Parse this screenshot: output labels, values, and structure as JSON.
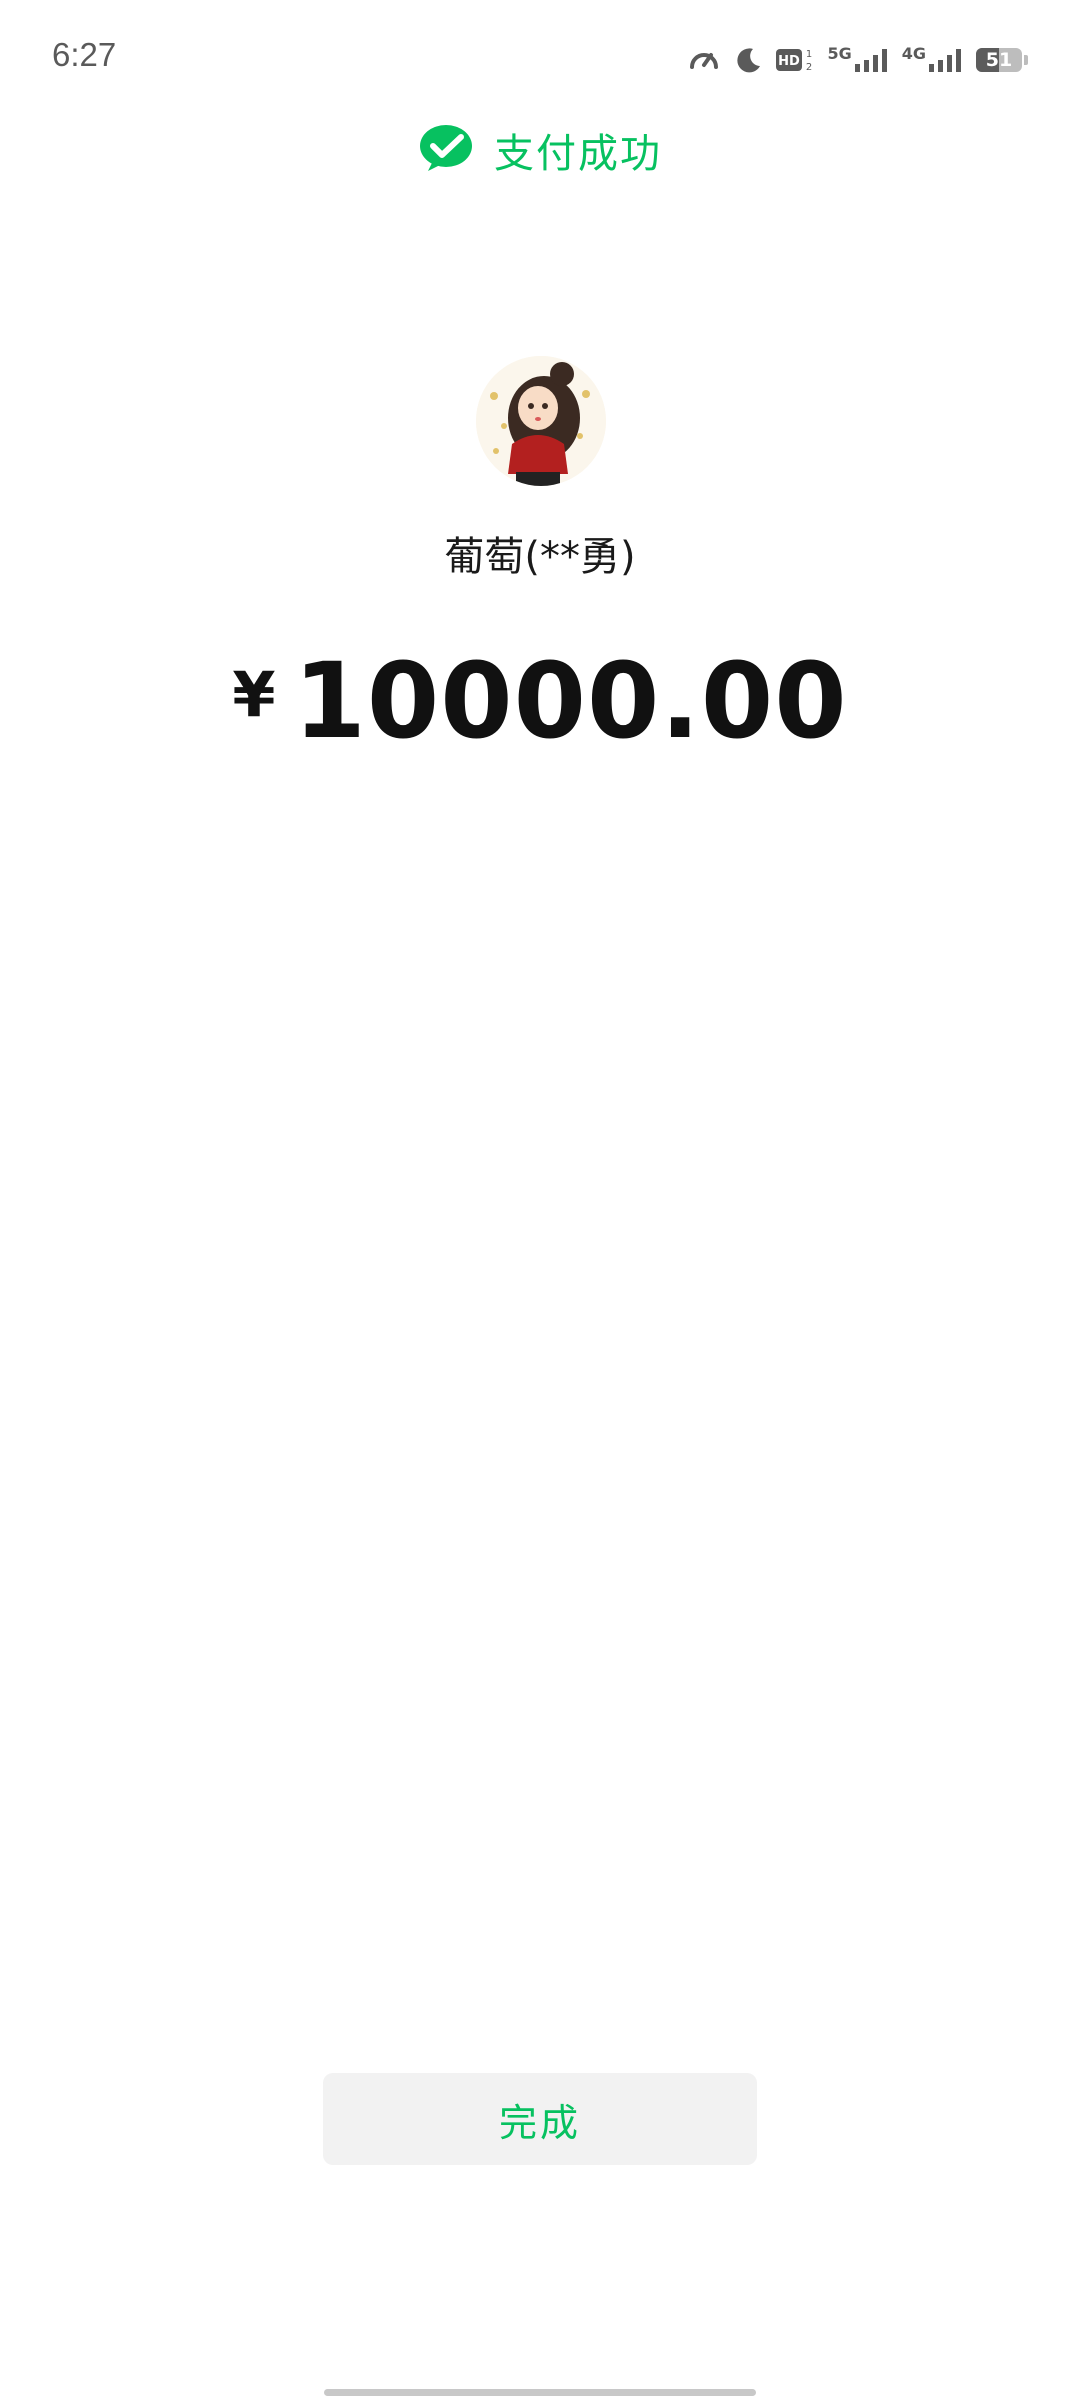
{
  "status_bar": {
    "time": "6:27",
    "network_1": "5G",
    "network_2": "4G",
    "hd_label": "HD",
    "battery_level": "51",
    "battery_fraction": 0.51
  },
  "header": {
    "title": "支付成功",
    "icon": "wechat-pay-icon",
    "accent_color": "#07c160"
  },
  "payee": {
    "name": "葡萄(**勇)"
  },
  "payment": {
    "currency_symbol": "¥",
    "amount": "10000.00"
  },
  "footer": {
    "done_label": "完成"
  }
}
